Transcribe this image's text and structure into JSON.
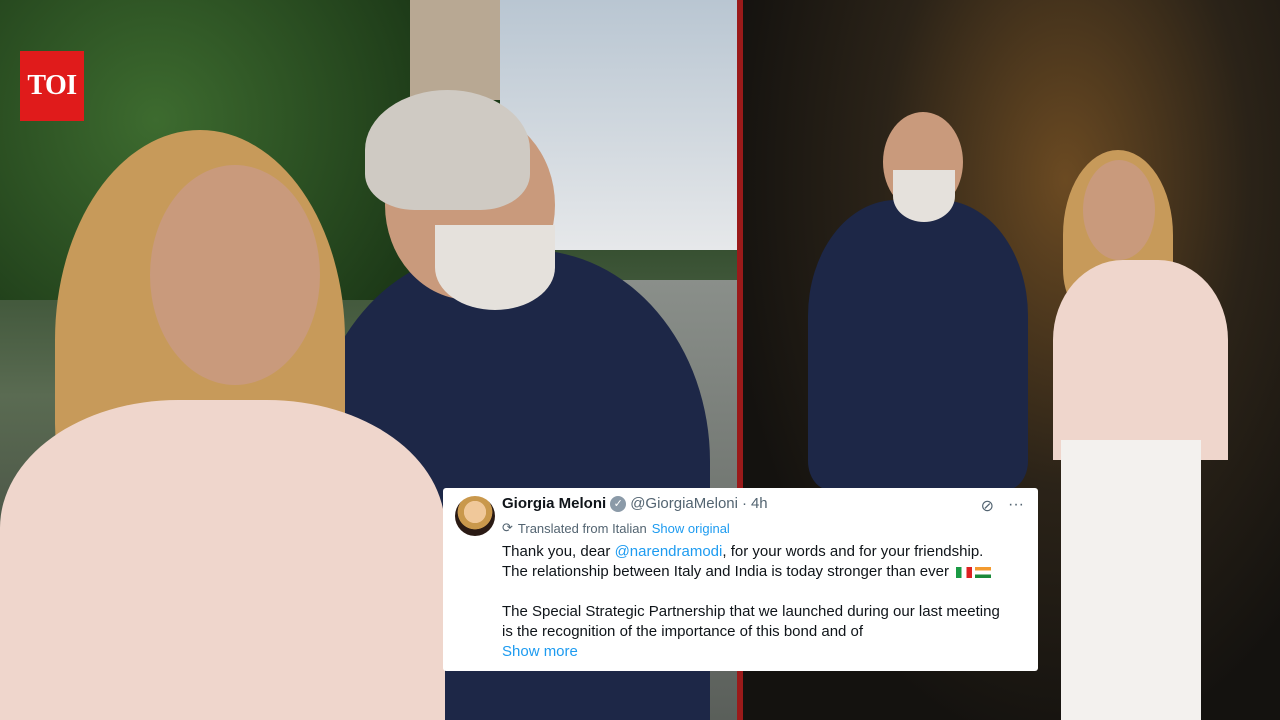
{
  "logo": {
    "text": "TOI",
    "color": "#e01b1b"
  },
  "tweet": {
    "author_name": "Giorgia Meloni",
    "verified_badge": "verified-icon",
    "handle": "@GiorgiaMeloni",
    "separator": "·",
    "time": "4h",
    "translation_note": "Translated from Italian",
    "show_original": "Show original",
    "line1_before_mention": "Thank you, dear ",
    "mention": "@narendramodi",
    "line1_after_mention": ", for your words and for your friendship.",
    "line2": "The relationship between Italy and India is today stronger than ever",
    "para2_line1": "The Special Strategic Partnership that we launched during our last meeting",
    "para2_line2": "is the recognition of the importance of this bond and of",
    "show_more": "Show more",
    "accent_color": "#1d9bf0"
  }
}
